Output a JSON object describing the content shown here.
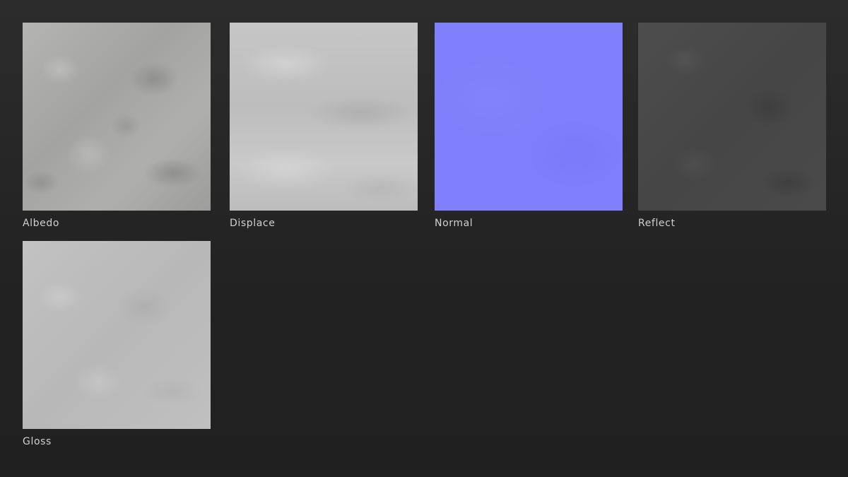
{
  "maps": [
    {
      "label": "Albedo",
      "icon": "albedo-texture",
      "color": "#a9a9a7"
    },
    {
      "label": "Displace",
      "icon": "displacement-texture",
      "color": "#c3c3c3"
    },
    {
      "label": "Normal",
      "icon": "normal-map-texture",
      "color": "#7f7ffb"
    },
    {
      "label": "Reflect",
      "icon": "reflection-texture",
      "color": "#494949"
    },
    {
      "label": "Gloss",
      "icon": "gloss-texture",
      "color": "#bdbdbd"
    }
  ],
  "colors": {
    "background": "#262626",
    "label_text": "#d0d0d0"
  }
}
